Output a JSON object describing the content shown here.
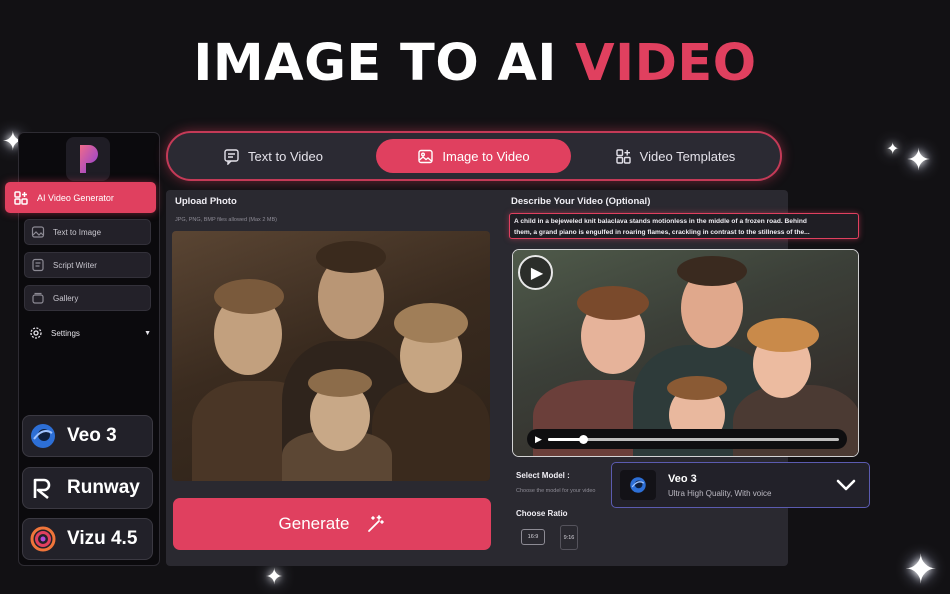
{
  "hero": {
    "title_main": "IMAGE TO AI ",
    "title_accent": "VIDEO"
  },
  "colors": {
    "accent": "#e0405f",
    "background": "#121114",
    "panel": "#2a2930"
  },
  "sidebar": {
    "active_item": "AI Video Generator",
    "items": [
      "Text to Image",
      "Script Writer",
      "Gallery"
    ],
    "settings": "Settings",
    "models": [
      "Veo 3",
      "Runway",
      "Vizu 4.5"
    ]
  },
  "tabs": [
    {
      "label": "Text to Video",
      "icon": "chat-icon",
      "active": false
    },
    {
      "label": "Image to Video",
      "icon": "image-icon",
      "active": true
    },
    {
      "label": "Video Templates",
      "icon": "grid-plus-icon",
      "active": false
    }
  ],
  "upload": {
    "label": "Upload Photo",
    "hint": "JPG, PNG, BMP files allowed (Max 2 MB)"
  },
  "generate_label": "Generate",
  "describe": {
    "label": "Describe Your Video (Optional)",
    "line1": "A child in a bejeweled knit balaclava stands motionless in the middle of a frozen road. Behind",
    "line2": "them, a grand piano is engulfed in roaring flames, crackling in contrast to the stillness of the..."
  },
  "player": {
    "progress": 0.12
  },
  "model": {
    "label": "Select Model :",
    "hint": "Choose the model for your video",
    "selected_name": "Veo 3",
    "selected_desc": "Ultra High Quality, With voice"
  },
  "ratio": {
    "label": "Choose Ratio",
    "options": [
      "16:9",
      "9:16"
    ]
  }
}
